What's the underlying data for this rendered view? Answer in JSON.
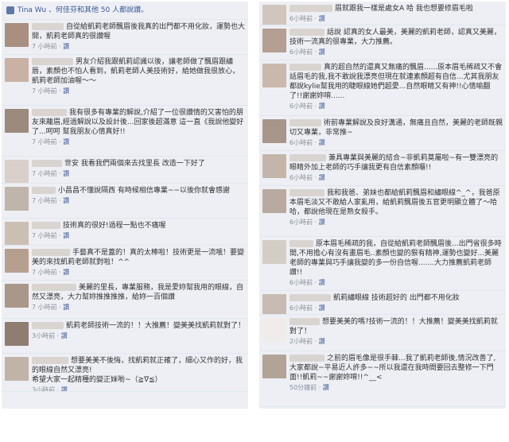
{
  "left": {
    "likes_text": "Tina Wu 、何佳芬和其他 50 人都說讚。",
    "comments": [
      {
        "text": "自從給凱莉老師飄眉後我真的出門都不用化妝，運勢也大開，凱莉老師真的很讚喔",
        "time": "7 小時前",
        "like": "讚"
      },
      {
        "text": "男友介紹我跟凱莉認識以後，讓老師做了飄眉跟繡唇，素顏也不怕人看到，凱莉老師人美技術好，給她做我很放心，凱莉老師加油喔～～",
        "time": "7 小時前",
        "like": "讚"
      },
      {
        "text": "我有很多有專業的解說,介紹了一位很讚情的又害怕的朋友來離眉,經過解說以及設計後...回家後超滿意 這一直《我說他變好了...呵呵 幫我朋友心情真好!!",
        "time": "7 小時前",
        "like": "讚"
      },
      {
        "text": "世安 我看我們兩個來去找里長 改造一下好了",
        "time": "7 小時前",
        "like": "讚"
      },
      {
        "text": "小昌昌不懂說隔西 有時候相信專業~~以後你就會感謝",
        "time": "7 小時前",
        "like": "讚"
      },
      {
        "text": "技術真的很好!過程一點也不痛喔",
        "time": "7 小時前",
        "like": "讚"
      },
      {
        "text": "手藝真不是蓋的！真的太棒啦！技術更是一流哦！要變美的來找凱莉老師就對啦！^^",
        "time": "7 小時前",
        "like": "讚"
      },
      {
        "text": "美麗的里長，專業服務，我是愛妳幫我用的眼線，自然又漂亮，大力幫妳推推推推，給妳一百個讚",
        "time": "7 小時前",
        "like": "讚"
      },
      {
        "text": "凱莉老師技術一流的！！大推薦！變美美找凱莉就對了！",
        "time": "3小時前",
        "like": "讚"
      },
      {
        "text": "想要美美不後悔，找凱莉就正確了，細心又作的好，我的眼線自然又漂亮!\n希望大家一起精種的變正妹喲~（≧∇≦）",
        "time": "3小時前",
        "like": "讚"
      }
    ]
  },
  "right": {
    "comments": [
      {
        "text": "眉就跟我一樣是處女A 哈 我也想要修眉毛啦",
        "time": "6小時前",
        "like": "讚"
      },
      {
        "text": "話說 認真的女人最美，美麗的凱莉老師，認真又美麗，技術一流真的很專業，大力推薦。",
        "time": "6小時前",
        "like": "讚"
      },
      {
        "text": "真的超自然的還真又無痛的飄眉......原本眉毛稀疏又不會話眉毛的我,我不敢說我漂亮但現在就連素顏超有自信...尤其我朋友都說kylie幫我用的睫眼線她們超愛...自然眼睛又有神!!心情喻翻了!!謝謝妳唷......",
        "time": "6小時前",
        "like": "讚"
      },
      {
        "text": "術前專業解說及良好溝通，無痛且自然，美麗的老師既親切又專業，非常推~",
        "time": "6小時前",
        "like": "讚"
      },
      {
        "text": "兼具專業與美麗的結合~非凱莉莫屬啦~有一雙漂亮的眼睛外加上老師的巧手讓我更有自信素顏囉!!",
        "time": "6小時前",
        "like": "讚"
      },
      {
        "text": "我和我爸、弟妹也都給凱莉飄眉和繡眼線^_^，我爸原本眉毛淡又不敢給人家亂用，給凱莉飄眉後五官更明顯立體了～哈哈，都說他現在是熟女殺手。",
        "time": "6小時前",
        "like": "讚"
      },
      {
        "text": "原本眉毛稀疏的我，自從給凱莉老師飄眉後...出門省很多時間,不用擔心有沒有畫眉毛..素顏也變的狠有精神,運勢也變好...美麗老師的專業與巧手讓我變的多一份自信喔.......大力推薦凱莉老師讚!!",
        "time": "6小時前",
        "like": "讚"
      },
      {
        "text": "凱莉繡眼線 技術超好的 出門都不用化妝",
        "time": "6小時前",
        "like": "讚"
      },
      {
        "text": "想要美美的嗎?技術一流的！！大推薦！變美美找凱莉就對了！",
        "time": "2小時前",
        "like": "讚"
      },
      {
        "text": "之前的眉毛像是很手棘...我了凱莉老師後,情況改善了,大家都說~平易近人許多~~所以我還在我時間要回去整修一下門面!!凱莉~~謝謝妳唷!!^__<",
        "time": "50分鐘前",
        "like": "讚"
      }
    ]
  },
  "colors": {
    "link": "#3b5998",
    "meta": "#898f9c",
    "panel": "#edeff4"
  }
}
